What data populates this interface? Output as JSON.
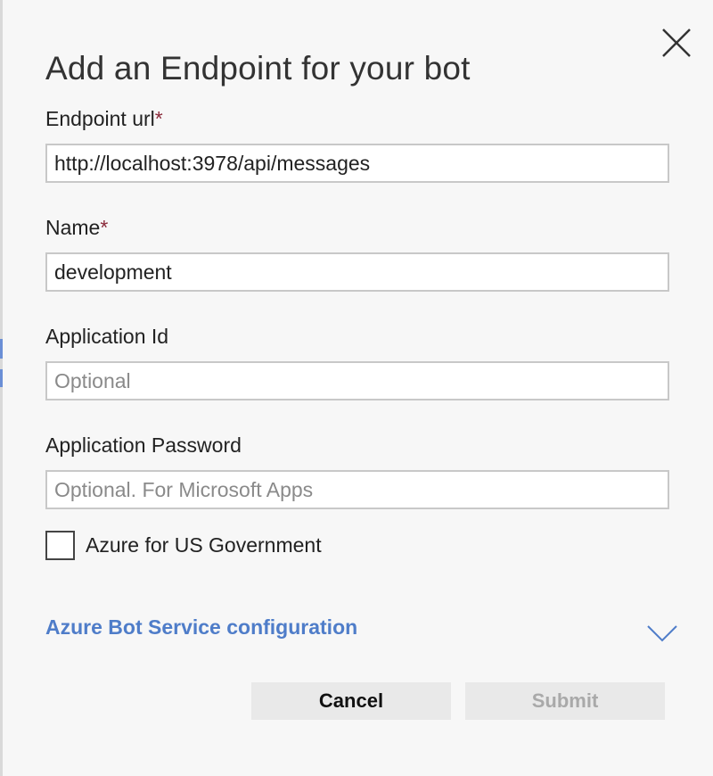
{
  "dialog": {
    "title": "Add an Endpoint for your bot",
    "close_icon": "close-icon"
  },
  "fields": {
    "endpoint_url": {
      "label": "Endpoint url",
      "required_mark": "*",
      "value": "http://localhost:3978/api/messages",
      "placeholder": ""
    },
    "name": {
      "label": "Name",
      "required_mark": "*",
      "value": "development",
      "placeholder": ""
    },
    "application_id": {
      "label": "Application Id",
      "value": "",
      "placeholder": "Optional"
    },
    "application_password": {
      "label": "Application Password",
      "value": "",
      "placeholder": "Optional. For Microsoft Apps"
    }
  },
  "checkbox": {
    "label": "Azure for US Government",
    "checked": false
  },
  "azure_section": {
    "label": "Azure Bot Service configuration",
    "expand_icon": "chevron-down-icon"
  },
  "buttons": {
    "cancel_label": "Cancel",
    "submit_label": "Submit",
    "submit_enabled": false
  },
  "colors": {
    "link_blue": "#4f7dc9",
    "required_star": "#8a2a3a",
    "button_bg": "#e9e9e9",
    "disabled_text": "#a9a9a9"
  }
}
